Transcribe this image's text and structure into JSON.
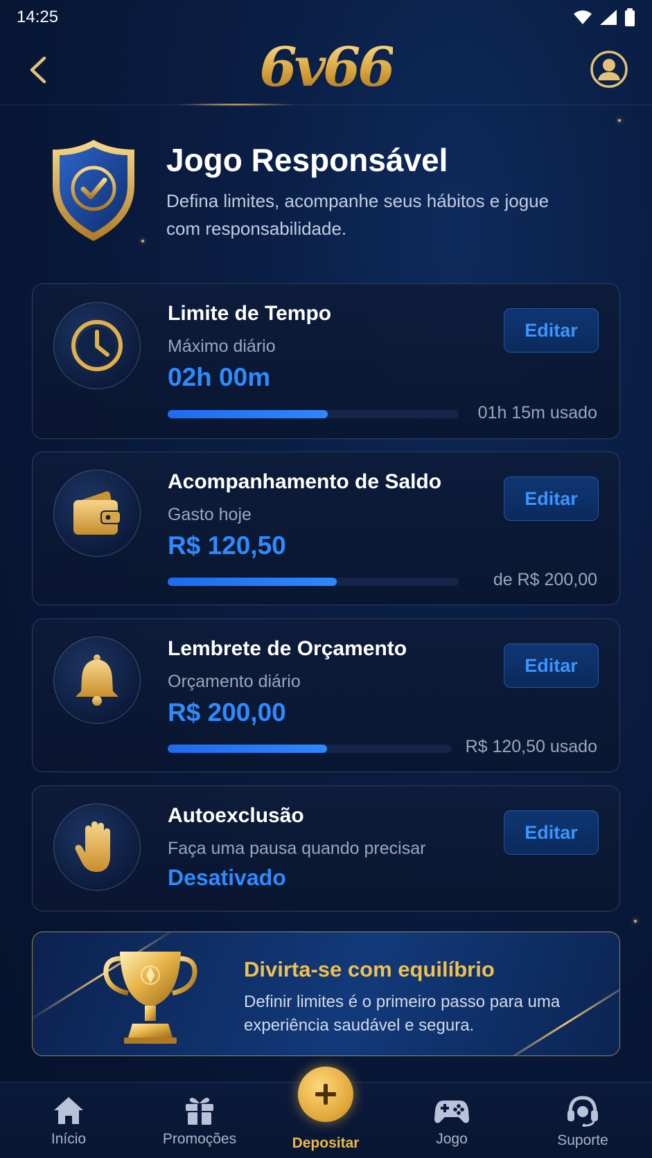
{
  "status_bar": {
    "time": "14:25"
  },
  "header": {
    "logo_text": "6v66"
  },
  "hero": {
    "title": "Jogo Responsável",
    "subtitle": "Defina limites, acompanhe seus hábitos e jogue com responsabilidade."
  },
  "cards": [
    {
      "title": "Limite de Tempo",
      "label": "Máximo diário",
      "value": "02h 00m",
      "edit_label": "Editar",
      "progress": 0.55,
      "note": "01h 15m usado",
      "icon": "clock-icon"
    },
    {
      "title": "Acompanhamento de Saldo",
      "label": "Gasto hoje",
      "value": "R$ 120,50",
      "edit_label": "Editar",
      "progress": 0.58,
      "note": "de R$ 200,00",
      "icon": "wallet-icon"
    },
    {
      "title": "Lembrete de Orçamento",
      "label": "Orçamento diário",
      "value": "R$ 200,00",
      "edit_label": "Editar",
      "progress": 0.56,
      "note": "R$ 120,50 usado",
      "icon": "bell-icon"
    },
    {
      "title": "Autoexclusão",
      "label": "Faça uma pausa quando precisar",
      "value": "Desativado",
      "edit_label": "Editar",
      "icon": "hand-icon"
    }
  ],
  "promo": {
    "title": "Divirta-se com equilíbrio",
    "text": "Definir limites é o primeiro passo para uma experiência saudável e segura."
  },
  "bottom_nav": {
    "items": [
      {
        "label": "Início",
        "icon": "home-icon"
      },
      {
        "label": "Promoções",
        "icon": "gift-icon"
      },
      {
        "label": "Depositar",
        "icon": "plus-icon",
        "active": true
      },
      {
        "label": "Jogo",
        "icon": "gamepad-icon"
      },
      {
        "label": "Suporte",
        "icon": "headset-icon"
      }
    ]
  },
  "colors": {
    "accent_blue": "#2e8bff",
    "gold": "#eab84a",
    "background": "#071634"
  }
}
